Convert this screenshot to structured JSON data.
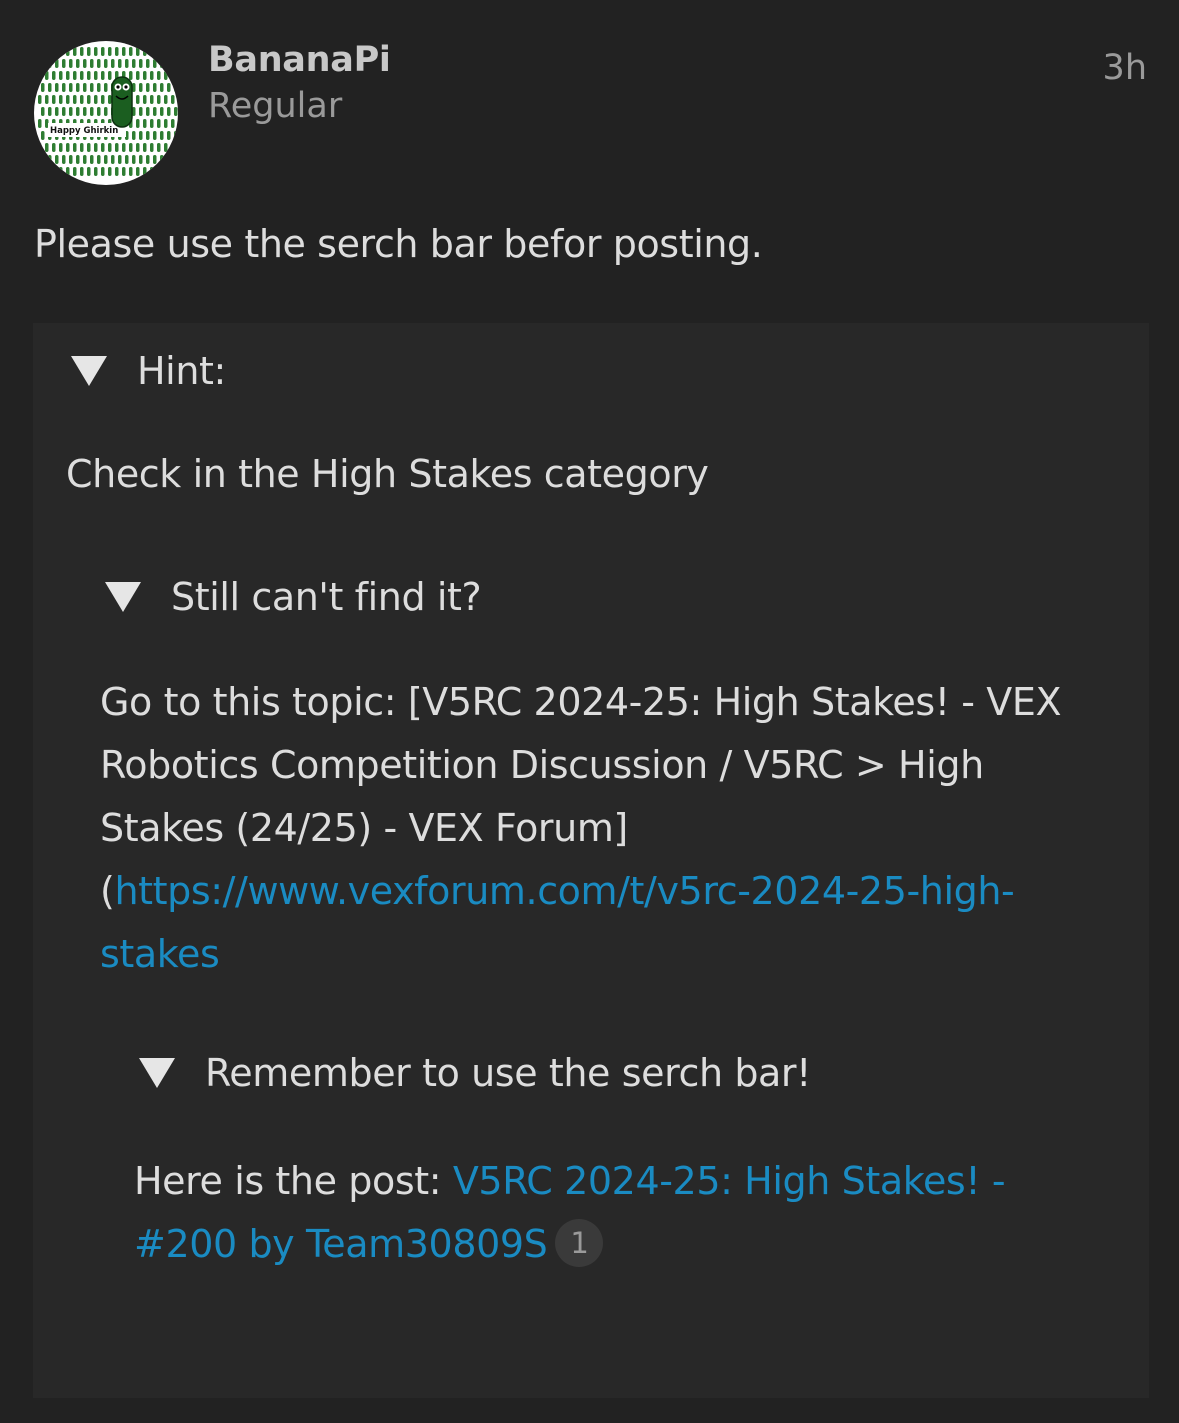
{
  "post": {
    "username": "BananaPi",
    "user_title": "Regular",
    "age": "3h",
    "avatar_text": "Happy Ghirkin",
    "body": "Please use the serch bar befor posting."
  },
  "hint": {
    "summary": "Hint:",
    "text": "Check in the High Stakes category",
    "nested": {
      "summary": "Still can't find it?",
      "text_prefix": "Go to this topic: [V5RC 2024-25: High Stakes! - VEX Robotics Competition Discussion / V5RC > High Stakes (24/25) - VEX Forum] (",
      "link_text": "https://www.vexforum.com/t/v5rc-2024-25-high-stakes",
      "nested": {
        "summary": "Remember to use the serch bar!",
        "text_prefix": "Here is the post: ",
        "link_text": "V5RC 2024-25: High Stakes! - #200 by Team30809S",
        "badge": "1"
      }
    }
  },
  "colors": {
    "background": "#222222",
    "details_background": "#282828",
    "link": "#1a8bc2",
    "avatar_green": "#2e7d32"
  },
  "icons": {
    "summary_marker": "triangle-down-icon"
  }
}
